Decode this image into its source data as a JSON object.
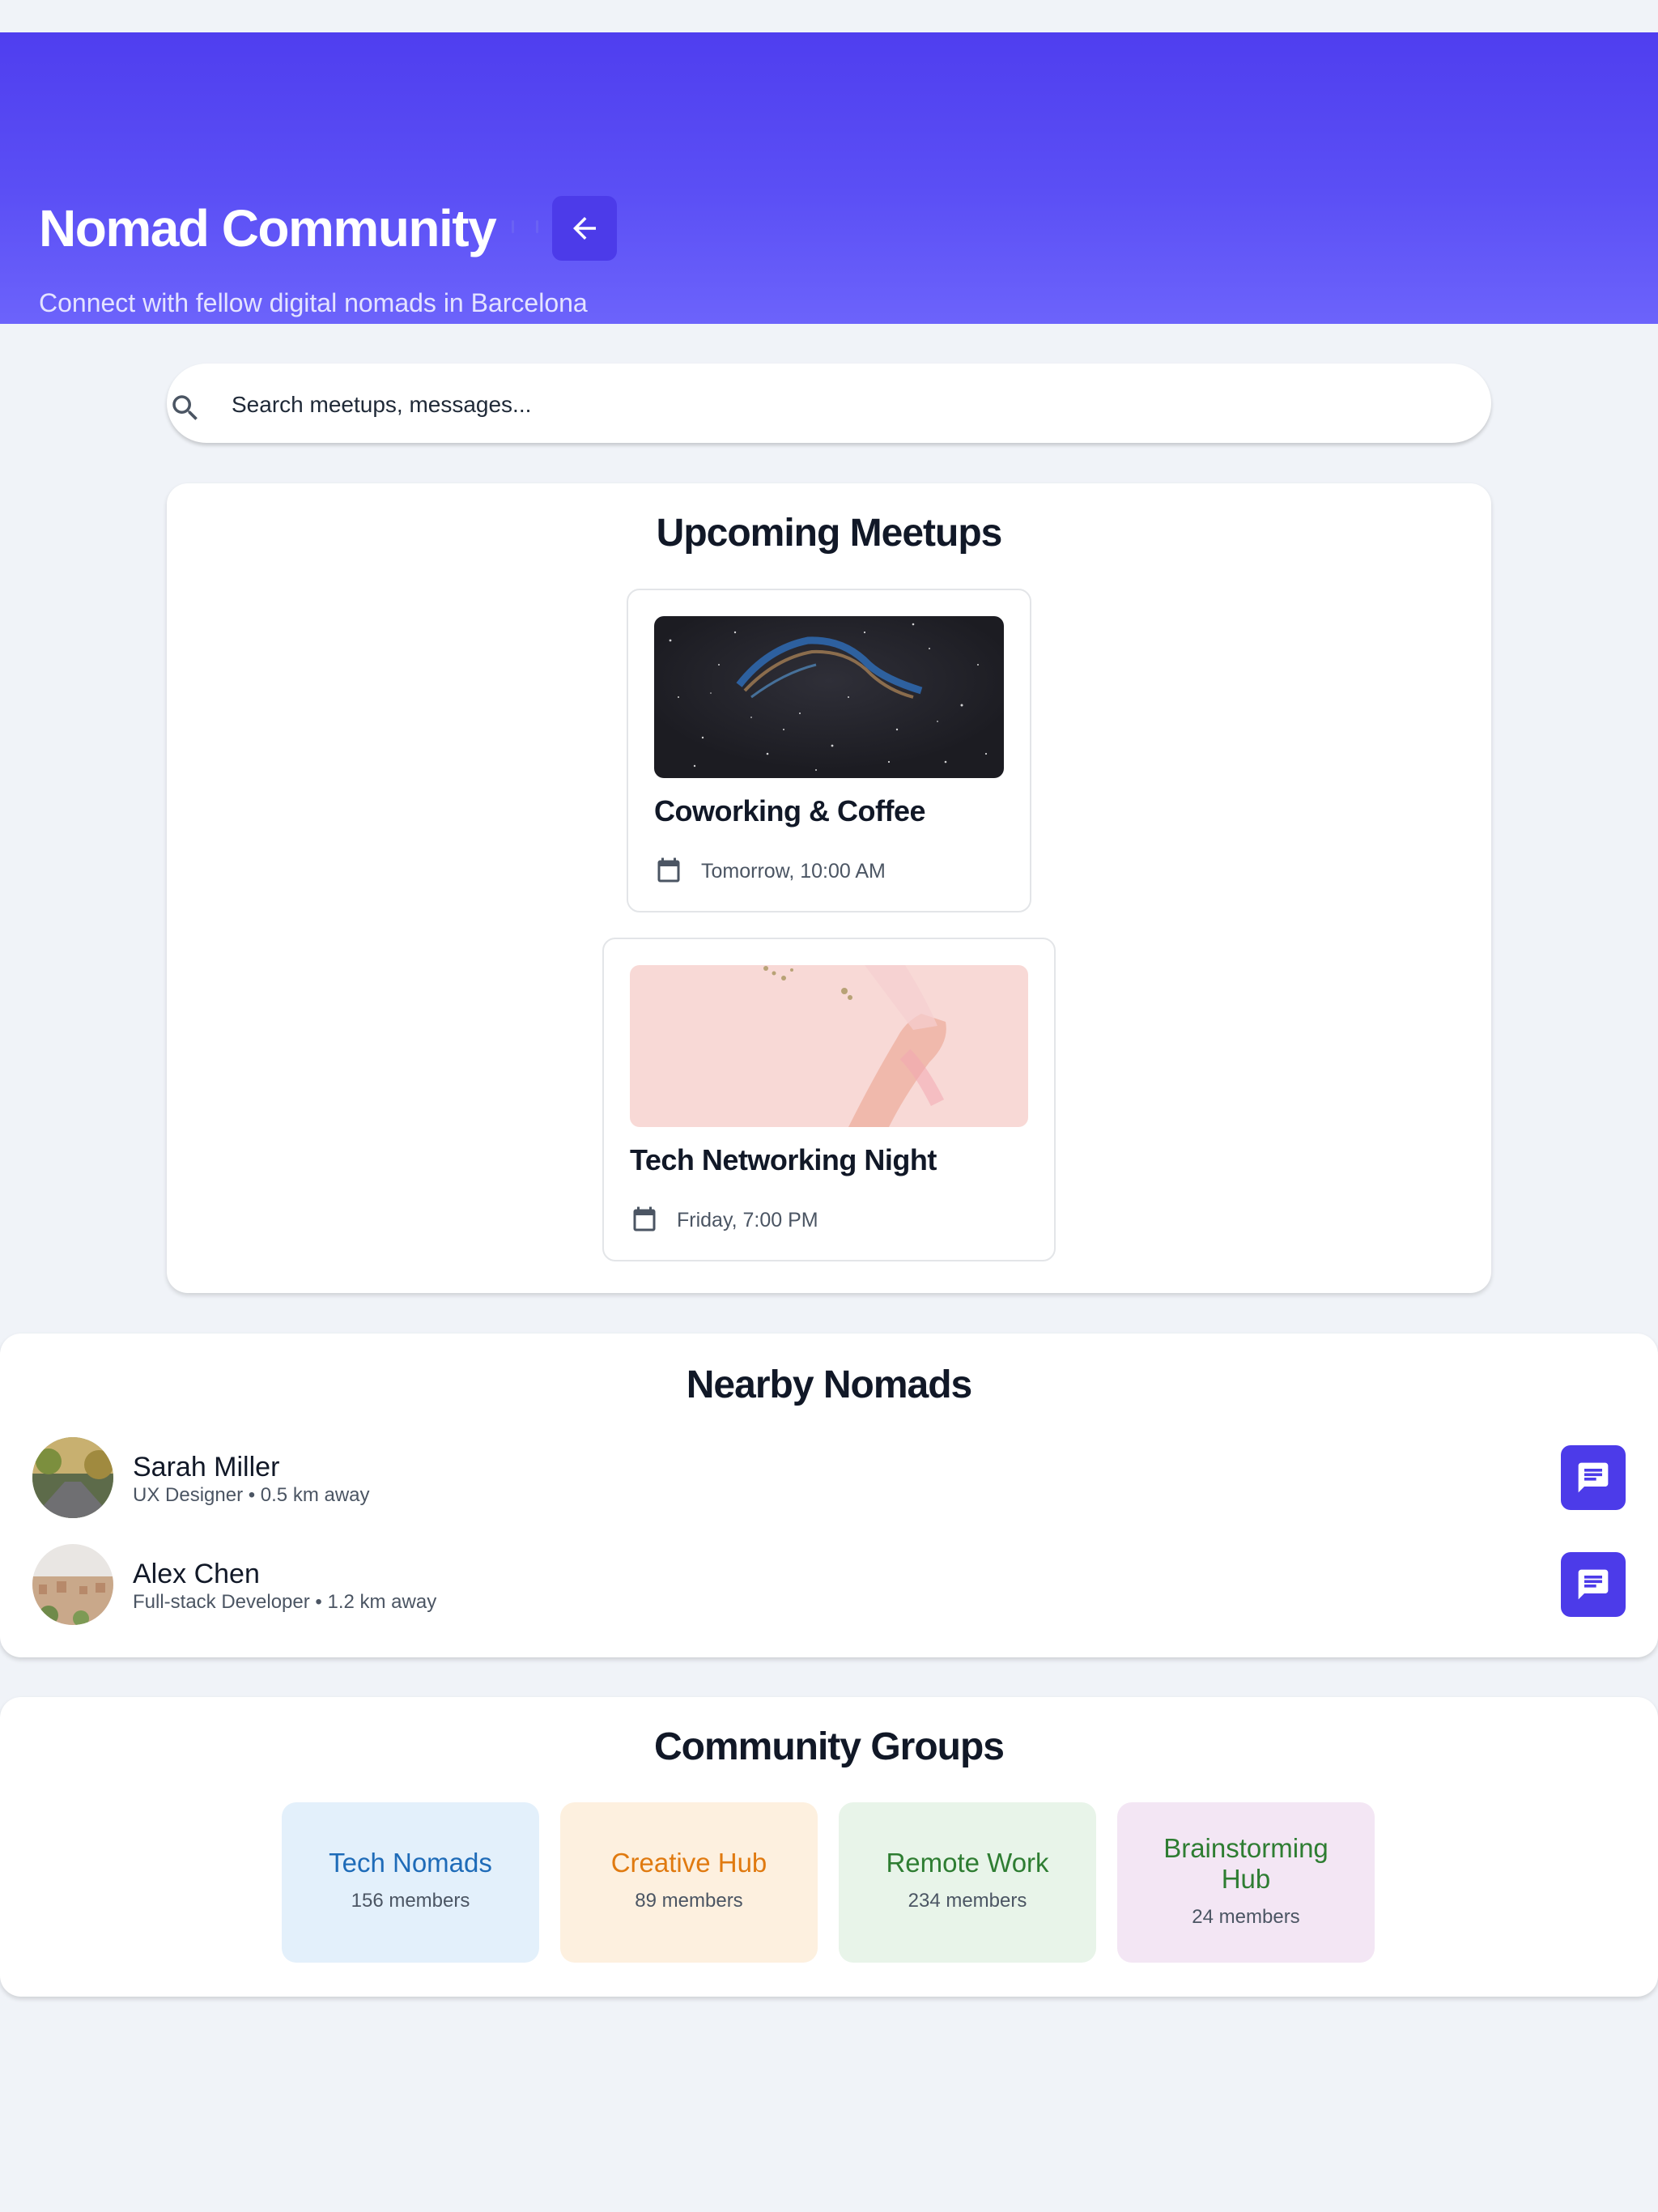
{
  "header": {
    "title": "Nomad Community",
    "subtitle": "Connect with fellow digital nomads in Barcelona"
  },
  "search": {
    "placeholder": "Search meetups, messages..."
  },
  "meetups": {
    "heading": "Upcoming Meetups",
    "items": [
      {
        "title": "Coworking & Coffee",
        "time": "Tomorrow, 10:00 AM"
      },
      {
        "title": "Tech Networking Night",
        "time": "Friday, 7:00 PM"
      }
    ]
  },
  "nomads": {
    "heading": "Nearby Nomads",
    "items": [
      {
        "name": "Sarah Miller",
        "meta": "UX Designer • 0.5 km away"
      },
      {
        "name": "Alex Chen",
        "meta": "Full-stack Developer • 1.2 km away"
      }
    ]
  },
  "groups": {
    "heading": "Community Groups",
    "items": [
      {
        "name": "Tech Nomads",
        "members": "156 members",
        "bg": "#e3f0fb",
        "color": "#1e6bb8"
      },
      {
        "name": "Creative Hub",
        "members": "89 members",
        "bg": "#fdf0df",
        "color": "#e07a10"
      },
      {
        "name": "Remote Work",
        "members": "234 members",
        "bg": "#e8f4e9",
        "color": "#2e7d32"
      },
      {
        "name": "Brainstorming Hub",
        "members": "24 members",
        "bg": "#f3e6f4",
        "color": "#2e7d32"
      }
    ]
  },
  "colors": {
    "accent": "#4c3be9",
    "page_bg": "#f0f3f8"
  },
  "icons": {
    "back": "arrow-left-icon",
    "search": "search-icon",
    "calendar": "calendar-icon",
    "message": "chat-message-icon"
  }
}
